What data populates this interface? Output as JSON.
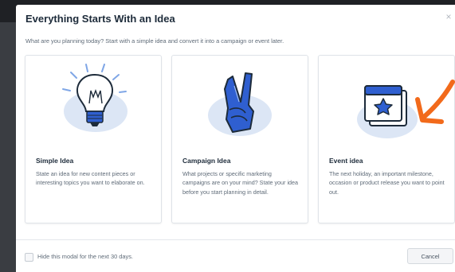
{
  "modal": {
    "title": "Everything Starts With an Idea",
    "close_label": "×",
    "subtitle": "What are you planning today? Start with a simple idea and convert it into a campaign or event later."
  },
  "cards": [
    {
      "title": "Simple Idea",
      "description": "State an idea for new content pieces or interesting topics you want to elaborate on.",
      "icon": "lightbulb-icon"
    },
    {
      "title": "Campaign Idea",
      "description": "What projects or specific marketing campaigns are on your mind? State your idea before you start planning in detail.",
      "icon": "peace-hand-icon"
    },
    {
      "title": "Event idea",
      "description": "The next holiday, an important milestone, occasion or product release you want to point out.",
      "icon": "calendar-star-icon"
    }
  ],
  "footer": {
    "hide_label": "Hide this modal for the next 30 days.",
    "cancel_label": "Cancel"
  },
  "colors": {
    "accent_blue": "#2f5fd0",
    "annotation_orange": "#f26a1b",
    "blob": "#dce6f5"
  }
}
